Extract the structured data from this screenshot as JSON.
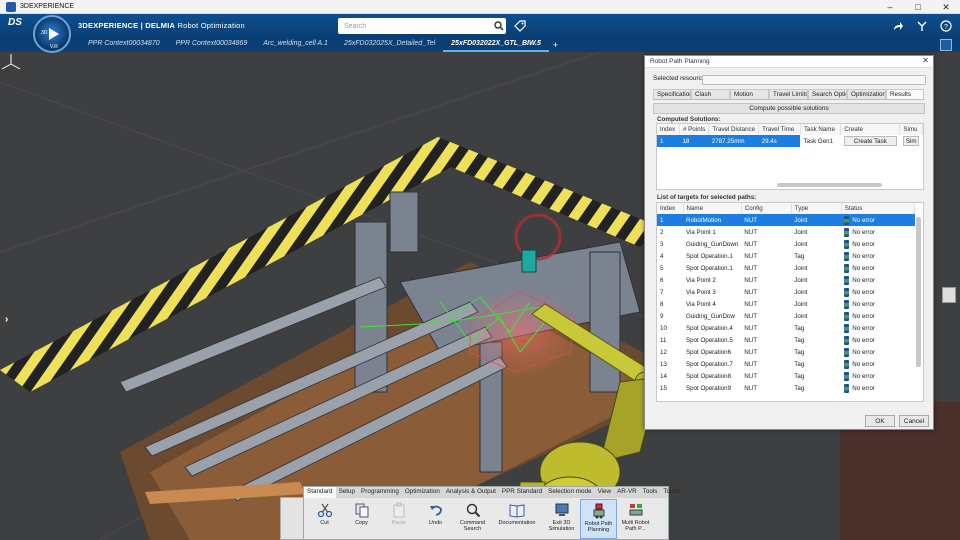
{
  "window": {
    "title": "3DEXPERIENCE"
  },
  "header": {
    "brand_bold": "3DEXPERIENCE | DELMIA",
    "brand_app": "Robot Optimization",
    "compass_v_r": "V.R",
    "compass_3d": "3D",
    "search_placeholder": "Search"
  },
  "tabs": [
    {
      "label": "PPR Context00034870"
    },
    {
      "label": "PPR Context00034869"
    },
    {
      "label": "Arc_welding_cell A.1"
    },
    {
      "label": "25xFD032025X_Detailed_Tel"
    },
    {
      "label": "25xFD032022X_GTL_BIW.5",
      "active": true
    }
  ],
  "tab_add": "+",
  "dialog": {
    "title": "Robot Path Planning",
    "selected_resource_label": "Selected resource:",
    "tabs": [
      "Specification",
      "Clash",
      "Motion",
      "Travel Limits",
      "Search Optio",
      "Optimization",
      "Results"
    ],
    "active_tab": "Results",
    "compute_button": "Compute possible solutions",
    "computed_label": "Computed Solutions:",
    "solutions_columns": [
      "Index",
      "# Points",
      "Travel Distance",
      "Travel Time",
      "Task Name",
      "Create",
      "Simu"
    ],
    "solutions_rows": [
      {
        "index": "1",
        "points": "18",
        "distance": "2787.25mm",
        "time": "29.4s",
        "task_name": "Task Gen1",
        "create": "Create Task",
        "simu": "Sim"
      }
    ],
    "targets_label": "List of targets for selected paths:",
    "targets_columns": [
      "Index",
      "Name",
      "Config",
      "Type",
      "Status"
    ],
    "targets_rows": [
      {
        "index": "1",
        "name": "RobotMotion",
        "config": "NUT",
        "type": "Joint",
        "status": "No error"
      },
      {
        "index": "2",
        "name": "Via Point 1",
        "config": "NUT",
        "type": "Joint",
        "status": "No error"
      },
      {
        "index": "3",
        "name": "Guiding_GunDown",
        "config": "NUT",
        "type": "Joint",
        "status": "No error"
      },
      {
        "index": "4",
        "name": "Spot Operation.1",
        "config": "NUT",
        "type": "Tag",
        "status": "No error"
      },
      {
        "index": "5",
        "name": "Spot Operation.1",
        "config": "NUT",
        "type": "Joint",
        "status": "No error"
      },
      {
        "index": "6",
        "name": "Via Point 2",
        "config": "NUT",
        "type": "Joint",
        "status": "No error"
      },
      {
        "index": "7",
        "name": "Via Point 3",
        "config": "NUT",
        "type": "Joint",
        "status": "No error"
      },
      {
        "index": "8",
        "name": "Via Point 4",
        "config": "NUT",
        "type": "Joint",
        "status": "No error"
      },
      {
        "index": "9",
        "name": "Guiding_GunDow",
        "config": "NUT",
        "type": "Joint",
        "status": "No error"
      },
      {
        "index": "10",
        "name": "Spot Operation.4",
        "config": "NUT",
        "type": "Tag",
        "status": "No error"
      },
      {
        "index": "11",
        "name": "Spot Operation.5",
        "config": "NUT",
        "type": "Tag",
        "status": "No error"
      },
      {
        "index": "12",
        "name": "Spot Operation6",
        "config": "NUT",
        "type": "Tag",
        "status": "No error"
      },
      {
        "index": "13",
        "name": "Spot Operation.7",
        "config": "NUT",
        "type": "Tag",
        "status": "No error"
      },
      {
        "index": "14",
        "name": "Spot Operation8",
        "config": "NUT",
        "type": "Tag",
        "status": "No error"
      },
      {
        "index": "15",
        "name": "Spot Operation9",
        "config": "NUT",
        "type": "Tag",
        "status": "No error"
      }
    ],
    "ok": "OK",
    "cancel": "Cancel"
  },
  "toolbar": {
    "tabs": [
      "Standard",
      "Setup",
      "Programming",
      "Optimization",
      "Analysis & Output",
      "PPR Standard",
      "Selection mode",
      "View",
      "AR-VR",
      "Tools",
      "Touch"
    ],
    "active_tab": "Standard",
    "items": [
      {
        "label": "Cut",
        "icon": "scissors-icon"
      },
      {
        "label": "Copy",
        "icon": "copy-icon"
      },
      {
        "label": "Paste",
        "icon": "paste-icon",
        "disabled": true
      },
      {
        "label": "Undo",
        "icon": "undo-icon"
      },
      {
        "label": "Command Search",
        "icon": "search-icon"
      },
      {
        "label": "Documentation",
        "icon": "book-icon"
      },
      {
        "label": "Exit 3D Simulation",
        "icon": "exit-icon"
      },
      {
        "label": "Robot Path Planning",
        "icon": "robot-icon",
        "active": true
      },
      {
        "label": "Multi Robot Path P...",
        "icon": "multi-robot-icon"
      }
    ]
  },
  "colors": {
    "accent": "#0d4f8f",
    "selection": "#1b7ee0",
    "hazard_yellow": "#f2e25a",
    "robot_yellow": "#c8c62a"
  }
}
